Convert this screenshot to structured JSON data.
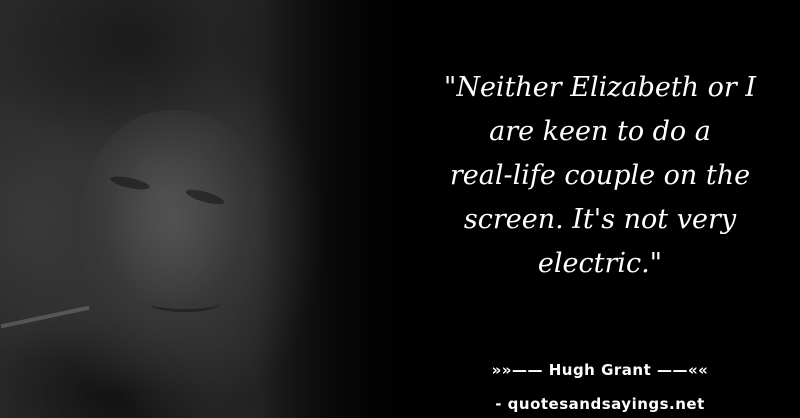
{
  "quote": {
    "lines": [
      "\"Neither Elizabeth or I",
      "are keen to do a",
      "real-life couple on the",
      "screen. It's not very",
      "electric.\""
    ]
  },
  "author": "»»—— Hugh Grant ——««",
  "source": "- quotesandsayings.net",
  "colors": {
    "background": "#000000",
    "text": "#ffffff"
  }
}
